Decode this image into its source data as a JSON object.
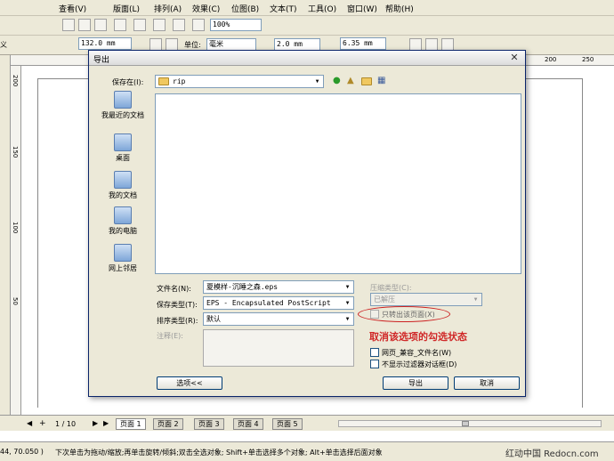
{
  "menubar": {
    "items": [
      "查看(V)",
      "版面(L)",
      "排列(A)",
      "效果(C)",
      "位图(B)",
      "文本(T)",
      "工具(O)",
      "窗口(W)",
      "帮助(H)"
    ]
  },
  "toolbar": {
    "zoom": "100%",
    "width_value": "132.0 mm",
    "unit_label": "单位:",
    "unit_value": "毫米",
    "outline_value": "2.0 mm",
    "offset_value": "6.35 mm",
    "left_edge_text": "义"
  },
  "ruler": {
    "h_ticks": [
      "200",
      "250"
    ],
    "v_ticks": [
      "200",
      "150",
      "100",
      "50"
    ]
  },
  "dialog": {
    "title": "导出",
    "save_in_label": "保存在(I):",
    "save_in_value": "rip",
    "places": [
      "我最近的文档",
      "桌面",
      "我的文档",
      "我的电脑",
      "网上邻居"
    ],
    "filename_label": "文件名(N):",
    "filename_value": "夏模样-沉睡之森.eps",
    "filetype_label": "保存类型(T):",
    "filetype_value": "EPS - Encapsulated PostScript",
    "sort_label": "排序类型(R):",
    "sort_value": "默认",
    "notes_label": "注释(E):",
    "compression_label": "压缩类型(C):",
    "compression_value": "已解压",
    "only_page_label": "只转出该页面(X)",
    "annotation": "取消该选项的勾选状态",
    "web_compat_label": "网页_兼容_文件名(W)",
    "no_filter_label": "不显示过滤器对话框(D)",
    "options_button": "选项<<",
    "export_button": "导出",
    "cancel_button": "取消"
  },
  "pagebar": {
    "page_count": "1 / 10",
    "tabs": [
      "页面 1",
      "页面 2",
      "页面 3",
      "页面 4",
      "页面 5"
    ]
  },
  "status": {
    "coords": "44, 70.050 )",
    "hint": "下次单击为拖动/缩放;再单击旋转/倾斜;双击全选对象; Shift+单击选择多个对象; Alt+单击选择后面对象",
    "watermark": "红动中国 Redocn.com"
  }
}
